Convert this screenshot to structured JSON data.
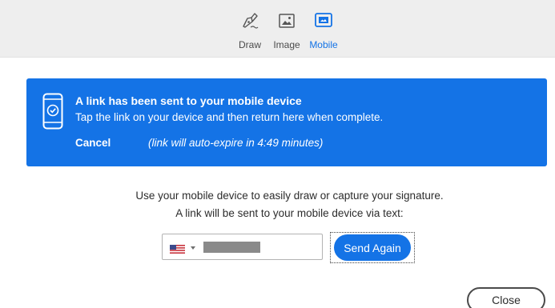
{
  "tabs": [
    {
      "label": "Draw",
      "icon": "pen-nib-icon",
      "active": false
    },
    {
      "label": "Image",
      "icon": "image-icon",
      "active": false
    },
    {
      "label": "Mobile",
      "icon": "mobile-icon",
      "active": true
    }
  ],
  "banner": {
    "title": "A link has been sent to your mobile device",
    "subtitle": "Tap the link on your device and then return here when complete.",
    "cancel_label": "Cancel",
    "expire_text": "(link will auto-expire in 4:49 minutes)",
    "icon": "phone-check-icon",
    "color": "#1473e6"
  },
  "instructions": {
    "line1": "Use your mobile device to easily draw or capture your signature.",
    "line2": "A link will be sent to your mobile device via text:"
  },
  "phone_input": {
    "country_icon": "us-flag-icon",
    "value_masked": true
  },
  "send_button": {
    "label": "Send Again"
  },
  "close_button": {
    "label": "Close"
  },
  "colors": {
    "accent": "#1473e6",
    "tabbar_bg": "#eeeeee"
  }
}
